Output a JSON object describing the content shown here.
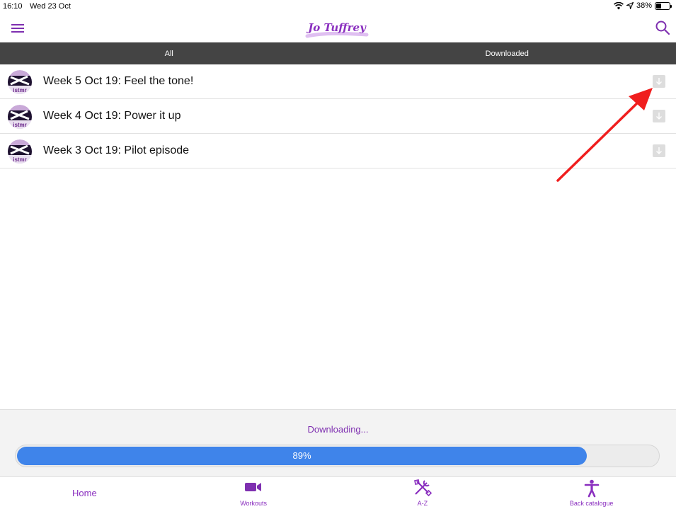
{
  "status_bar": {
    "time": "16:10",
    "date": "Wed 23 Oct",
    "battery": "38%",
    "battery_level": 0.38
  },
  "header": {
    "logo_text": "Jo Tuffrey",
    "accent_color": "#7e2fb0"
  },
  "tabs": [
    {
      "label": "All"
    },
    {
      "label": "Downloaded"
    }
  ],
  "episodes": [
    {
      "title": "Week 5 Oct 19: Feel the tone!",
      "thumb_text": "istmr"
    },
    {
      "title": "Week 4 Oct 19: Power it up",
      "thumb_text": "istmr"
    },
    {
      "title": "Week 3 Oct 19: Pilot episode",
      "thumb_text": "istmr"
    }
  ],
  "download": {
    "status": "Downloading...",
    "percent_label": "89%",
    "progress": 0.89,
    "bar_color": "#3f84ea"
  },
  "nav": [
    {
      "label": "Home",
      "icon": "none"
    },
    {
      "label": "Workouts",
      "icon": "video-camera-icon"
    },
    {
      "label": "A-Z",
      "icon": "tools-icon"
    },
    {
      "label": "Back catalogue",
      "icon": "person-icon"
    }
  ],
  "annotation": {
    "arrow_color": "#f01e1e"
  }
}
